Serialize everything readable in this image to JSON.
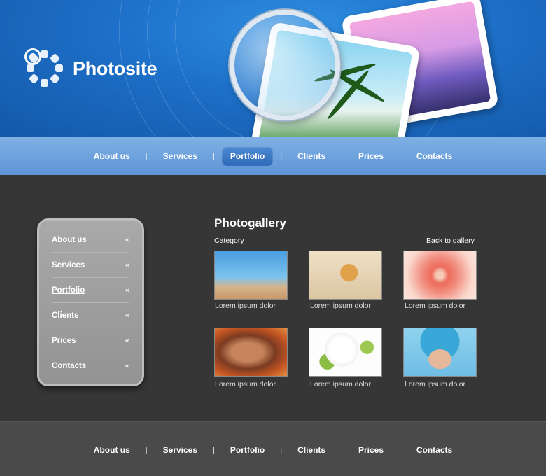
{
  "brand": {
    "name": "Photosite"
  },
  "nav": [
    {
      "label": "About us"
    },
    {
      "label": "Services"
    },
    {
      "label": "Portfolio"
    },
    {
      "label": "Clients"
    },
    {
      "label": "Prices"
    },
    {
      "label": "Contacts"
    }
  ],
  "nav_active": "Portfolio",
  "separator": "|",
  "sidebar": {
    "items": [
      {
        "label": "About us",
        "chevron": "«"
      },
      {
        "label": "Services",
        "chevron": "«"
      },
      {
        "label": "Portfolio",
        "chevron": "«"
      },
      {
        "label": "Clients",
        "chevron": "«"
      },
      {
        "label": "Prices",
        "chevron": "«"
      },
      {
        "label": "Contacts",
        "chevron": "«"
      }
    ]
  },
  "gallery": {
    "title": "Photogallery",
    "category": "Category",
    "back_link": "Back to gallery",
    "items": [
      {
        "caption": "Lorem ipsum dolor",
        "subject": "children-on-beach"
      },
      {
        "caption": "Lorem ipsum dolor",
        "subject": "starfish-on-sand"
      },
      {
        "caption": "Lorem ipsum dolor",
        "subject": "pink-rose"
      },
      {
        "caption": "Lorem ipsum dolor",
        "subject": "woman-portrait"
      },
      {
        "caption": "Lorem ipsum dolor",
        "subject": "white-blossom"
      },
      {
        "caption": "Lorem ipsum dolor",
        "subject": "woman-in-blue-hat"
      }
    ]
  },
  "colors": {
    "header_blue": "#1d6fc8",
    "nav_blue": "#6a9fdc",
    "active_tab": "#3c77c4",
    "body_dark": "#363636",
    "footer_gray": "#4a4a4a"
  }
}
